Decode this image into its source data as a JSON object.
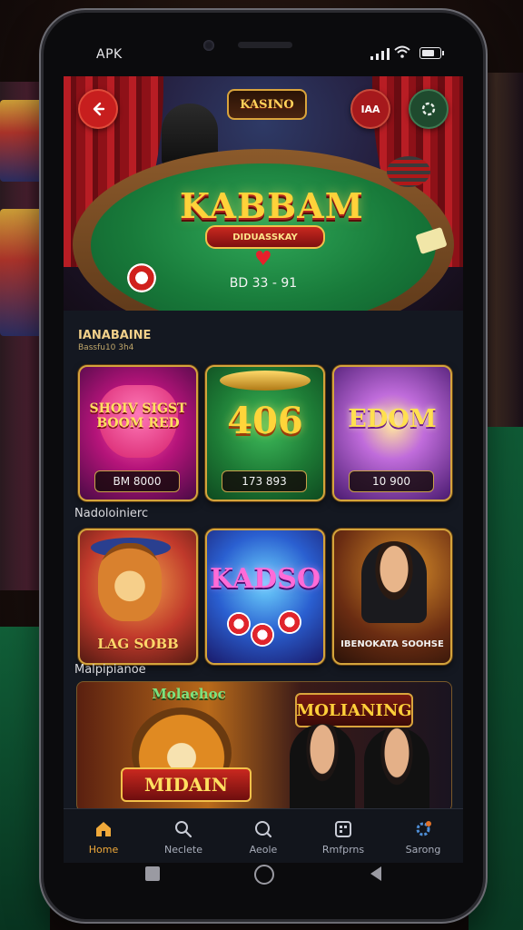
{
  "status_bar": {
    "carrier": "APK"
  },
  "hero": {
    "logo": "KASINO",
    "title": "KABBAM",
    "subtitle": "DIDUASSKAY",
    "jackpot": "BD 33 - 91",
    "lang_button": "IAA"
  },
  "section_featured": {
    "title": "IANABAINE",
    "subtitle": "Bassfu10 3h4"
  },
  "featured_tiles": [
    {
      "title": "SHOIV SIGST BOOM RED",
      "badge": "BM 8000"
    },
    {
      "title": "406",
      "badge": "173 893"
    },
    {
      "title": "EDOM",
      "badge": "10 900"
    }
  ],
  "section_popular": {
    "label": "Nadoloinierc"
  },
  "popular_tiles": [
    {
      "title": "LAG SOBB"
    },
    {
      "title": "KADSO"
    },
    {
      "title": "IBENOKATA SOOHSE"
    }
  ],
  "section_banner": {
    "label": "Malpipianoe"
  },
  "banner": {
    "left_top": "Molaehoc",
    "left_title": "MIDAIN",
    "right_title": "MOLIANING"
  },
  "bottom_nav": [
    {
      "label": "Home",
      "icon": "home-icon",
      "active": true
    },
    {
      "label": "Neclete",
      "icon": "search-icon"
    },
    {
      "label": "Aeole",
      "icon": "search-icon"
    },
    {
      "label": "Rmfprns",
      "icon": "grid-icon"
    },
    {
      "label": "Sarong",
      "icon": "gear-icon"
    }
  ],
  "colors": {
    "accent": "#f0a93a",
    "gold": "#d4a43c",
    "nav_bg": "#12151c"
  }
}
